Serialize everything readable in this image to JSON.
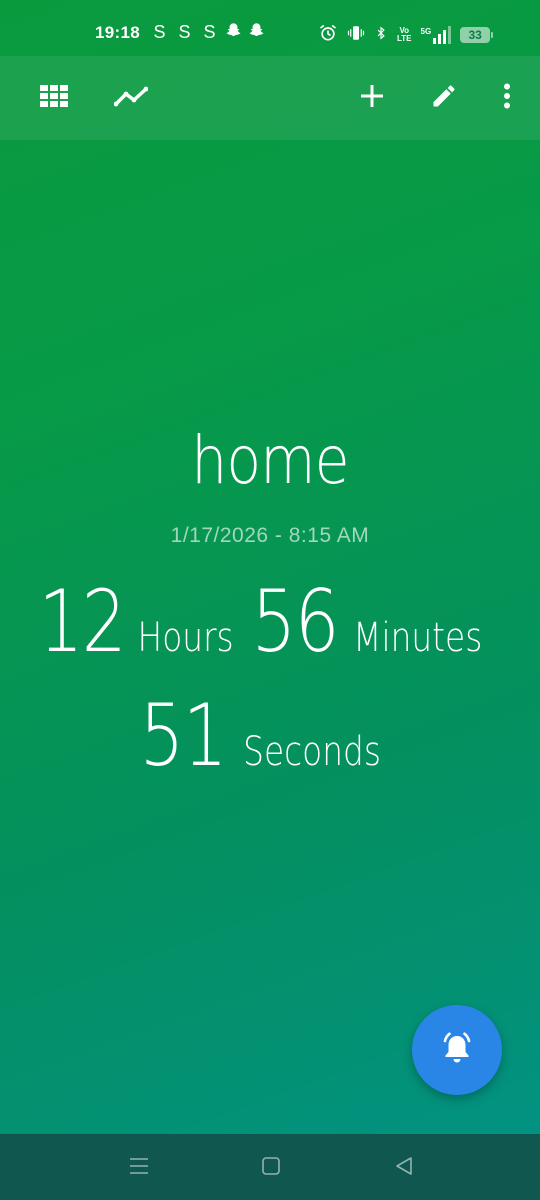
{
  "status_bar": {
    "time": "19:18",
    "left_icons": [
      "S",
      "S",
      "S"
    ],
    "snapchat_icons": [
      "snapchat-icon",
      "snapchat-icon"
    ],
    "right_icons": [
      "alarm-icon",
      "vibrate-icon",
      "bluetooth-icon",
      "volte-icon",
      "5g-signal-icon"
    ],
    "volte_top": "Vo",
    "volte_bottom": "LTE",
    "network": "5G",
    "battery": "33"
  },
  "toolbar": {
    "icons": [
      "grid-icon",
      "trend-icon",
      "add-icon",
      "edit-icon",
      "more-vert-icon"
    ]
  },
  "event": {
    "title": "home",
    "datetime": "1/17/2026 - 8:15 AM"
  },
  "countdown": {
    "hours_value": "12",
    "hours_label": "Hours",
    "minutes_value": "56",
    "minutes_label": "Minutes",
    "seconds_value": "51",
    "seconds_label": "Seconds"
  },
  "fab": {
    "icon": "bell-icon"
  },
  "nav": {
    "icons": [
      "recents-icon",
      "home-icon",
      "back-icon"
    ]
  },
  "colors": {
    "gradient_start": "#0a9a3e",
    "gradient_end": "#029287",
    "fab": "#2a86e6",
    "nav_bar": "#10574f"
  }
}
